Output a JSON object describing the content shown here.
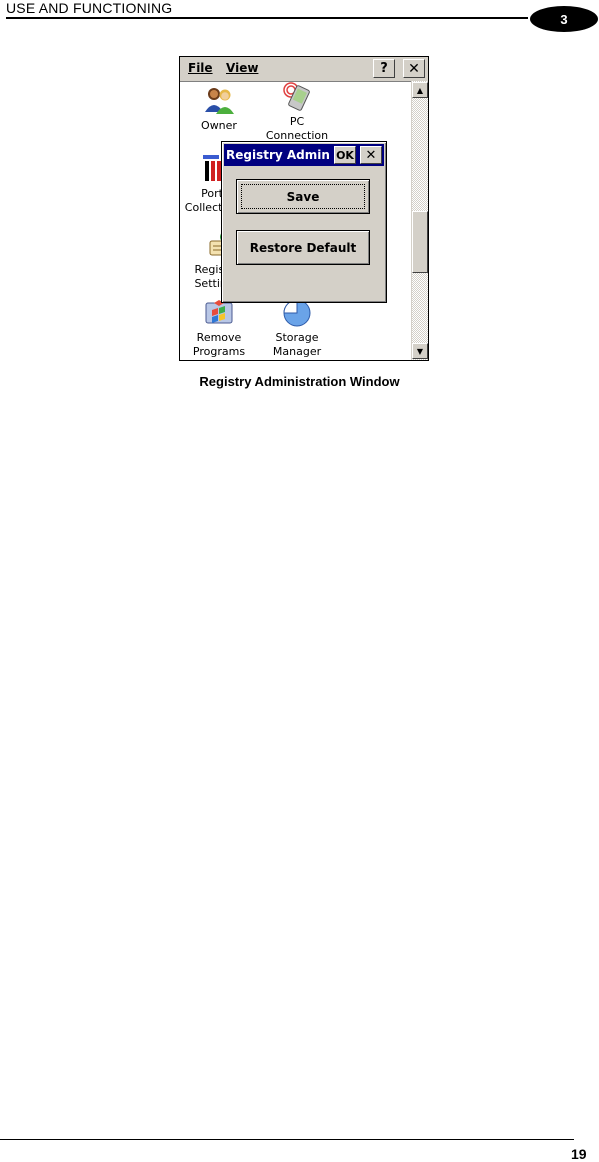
{
  "header": {
    "title": "USE AND FUNCTIONING",
    "chapter": "3"
  },
  "footer": {
    "page": "19"
  },
  "caption": "Registry Administration Window",
  "screen": {
    "menubar": {
      "file": "File",
      "view": "View",
      "help": "?",
      "close": "✕"
    },
    "scrollbar": {
      "up": "▲",
      "down": "▼"
    },
    "icons": [
      {
        "label": "Owner"
      },
      {
        "label": "PC Connection"
      },
      {
        "label": "Port Collection"
      },
      {
        "label": "Registry Settings"
      },
      {
        "label": "Remove Programs"
      },
      {
        "label": "Storage Manager"
      }
    ],
    "dialog": {
      "title": "Registry Admin",
      "ok": "OK",
      "close": "✕",
      "save": "Save",
      "restore": "Restore Default"
    }
  }
}
